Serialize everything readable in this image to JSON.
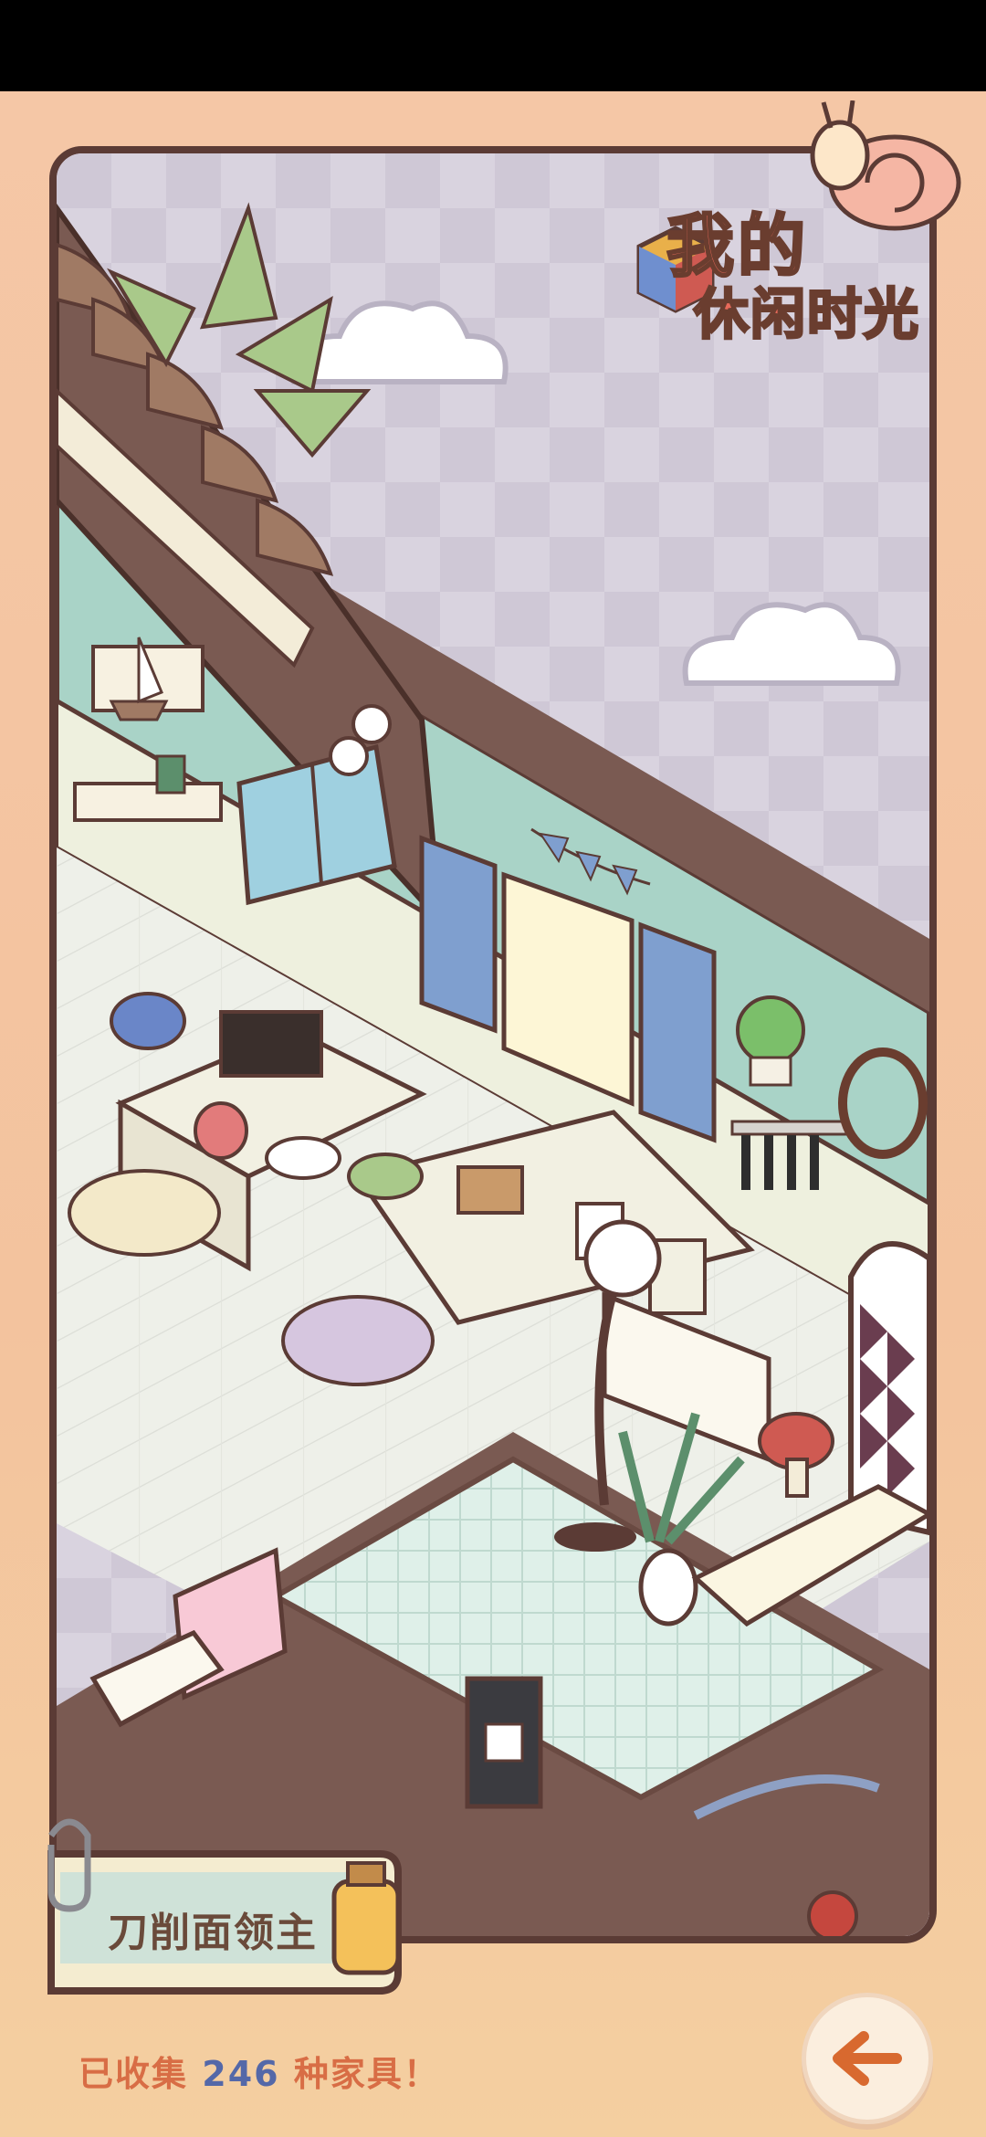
{
  "game": {
    "title_line1": "我的",
    "title_line2": "休闲时光"
  },
  "player": {
    "title": "刀削面领主"
  },
  "collection": {
    "prefix": "已收集",
    "count": "246",
    "suffix": "种家具！"
  },
  "icons": {
    "back": "arrow-left-icon",
    "snail": "snail-mascot-icon",
    "rubik": "rubik-cube-icon",
    "clip": "paperclip-icon"
  },
  "colors": {
    "accent_orange": "#d86d45",
    "count_blue": "#5468a8",
    "frame_brown": "#5b3b35"
  }
}
